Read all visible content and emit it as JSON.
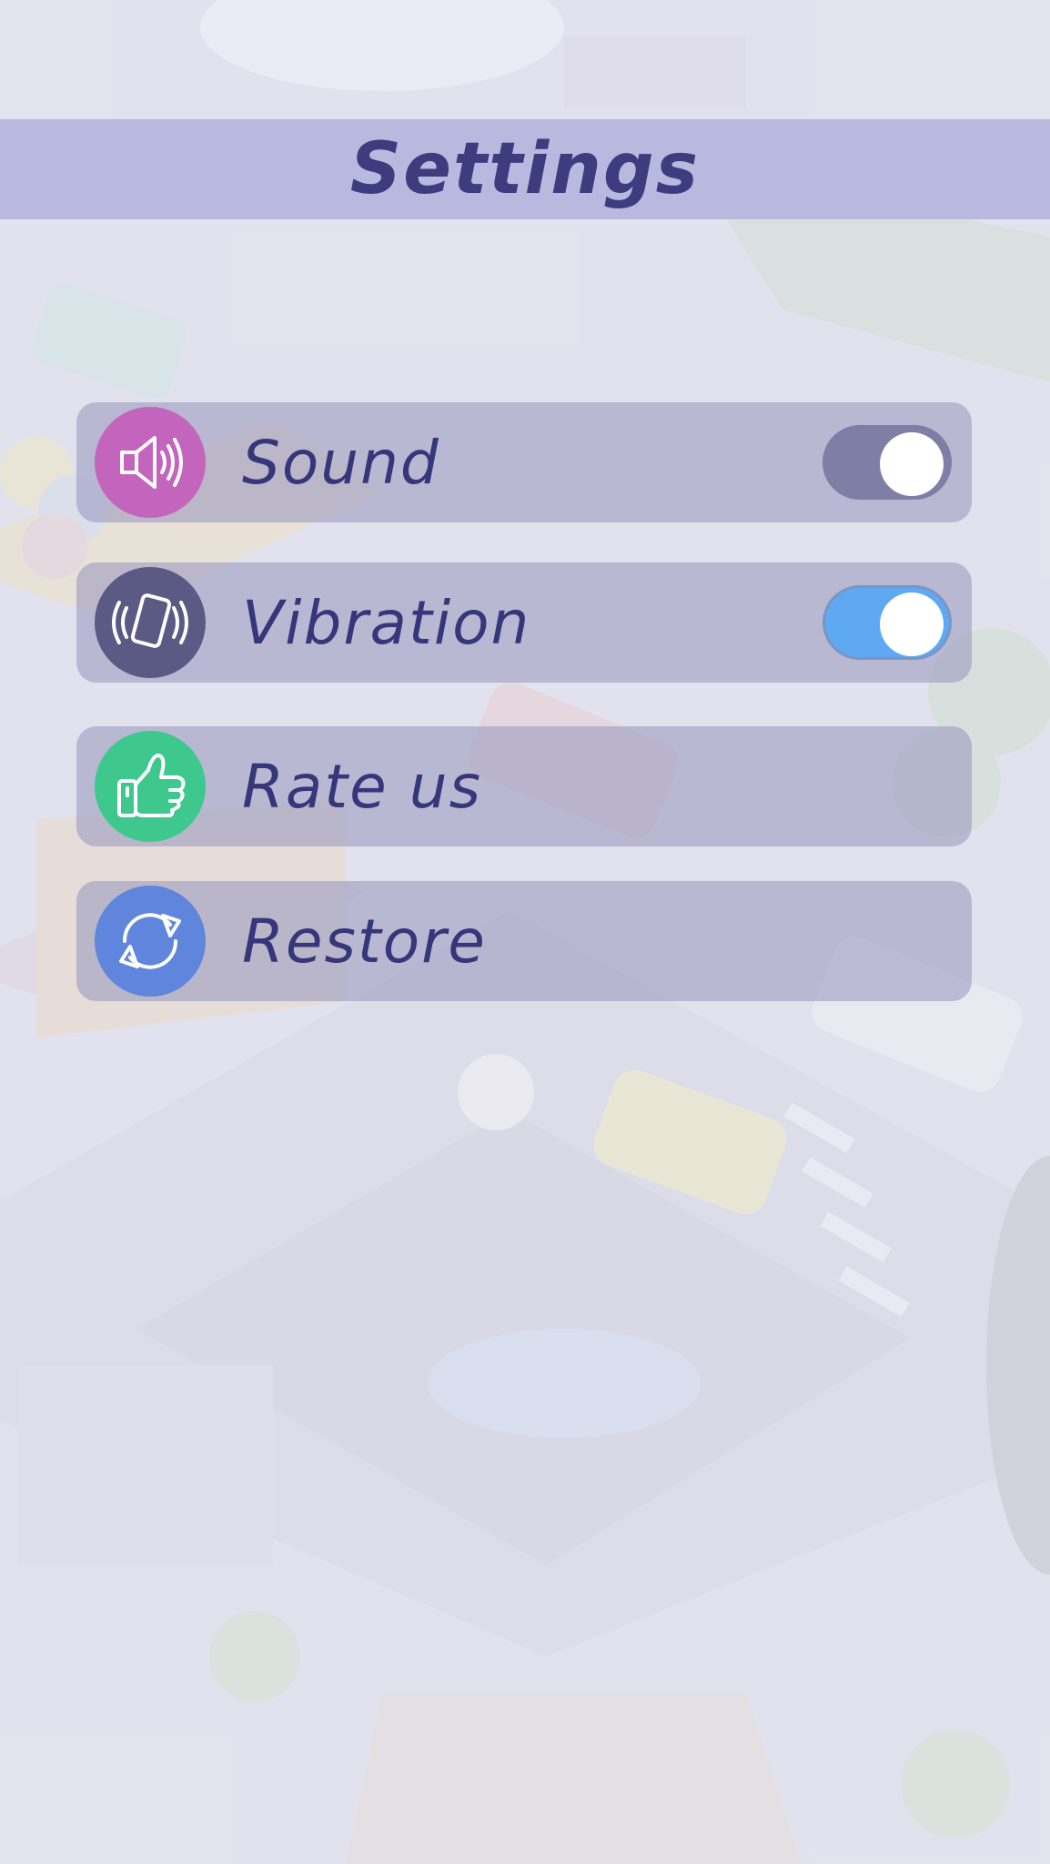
{
  "header": {
    "title": "Settings"
  },
  "settings": [
    {
      "id": "sound",
      "label": "Sound",
      "icon": "speaker-icon",
      "icon_color": "#c365bd",
      "type": "toggle",
      "on": false,
      "toggle_color": "#7f7fa6"
    },
    {
      "id": "vibration",
      "label": "Vibration",
      "icon": "phone-vibrate-icon",
      "icon_color": "#5a5a85",
      "type": "toggle",
      "on": true,
      "toggle_color": "#5fa9f2"
    },
    {
      "id": "rate",
      "label": "Rate us",
      "icon": "thumbs-up-icon",
      "icon_color": "#3fc88d",
      "type": "button"
    },
    {
      "id": "restore",
      "label": "Restore",
      "icon": "restore-icon",
      "icon_color": "#5f86dc",
      "type": "button"
    }
  ],
  "colors": {
    "title_bar": "#b9b9e0",
    "title_text": "#3c3c7e",
    "row_text": "#36367a"
  }
}
